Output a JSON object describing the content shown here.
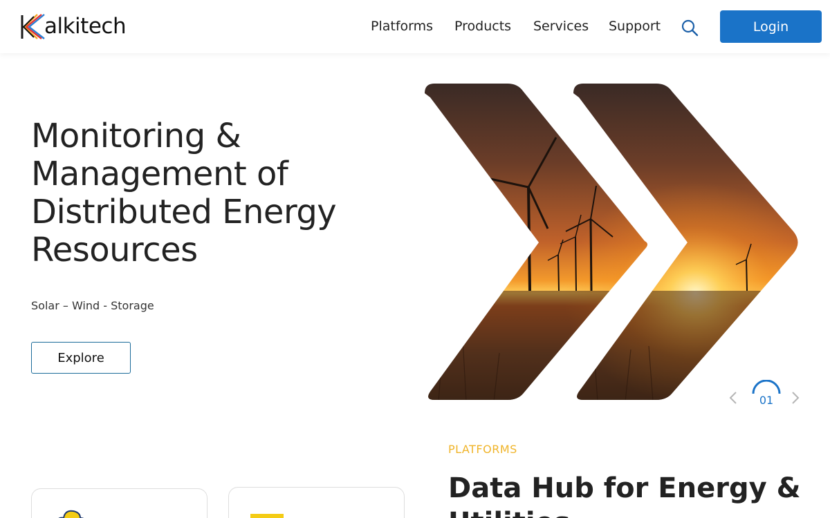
{
  "header": {
    "logo_text": "alkitech",
    "nav": [
      {
        "label": "Platforms"
      },
      {
        "label": "Products"
      },
      {
        "label": "Services"
      },
      {
        "label": "Support"
      }
    ],
    "search_icon": "search-icon",
    "login_label": "Login"
  },
  "hero": {
    "title_lines": [
      "Monitoring &",
      "Management of",
      "Distributed Energy",
      "Resources"
    ],
    "subtitle": "Solar – Wind - Storage",
    "explore_label": "Explore",
    "image_subject": "wind turbines at sunset over field",
    "slider": {
      "current": "01",
      "prev_icon": "chevron-left-icon",
      "next_icon": "chevron-right-icon"
    }
  },
  "platforms": {
    "label": "PLATFORMS",
    "title_lines": [
      "Data Hub for Energy &",
      "Utilities"
    ],
    "cards": [
      {
        "icon": "cloud-icon"
      },
      {
        "icon": "panel-icon"
      }
    ]
  },
  "colors": {
    "primary": "#1a73c8",
    "accent": "#f0b429",
    "text": "#222222"
  }
}
